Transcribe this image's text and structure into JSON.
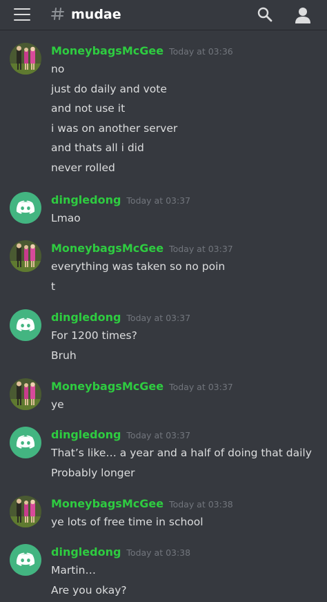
{
  "channel": {
    "name": "mudae"
  },
  "icons": {
    "menu": "hamburger-menu-icon",
    "channel": "text-channel-hash-icon",
    "search": "search-icon",
    "members": "members-icon"
  },
  "colors": {
    "background": "#36393f",
    "username": "#2ecc40",
    "timestamp": "#72767d",
    "text": "#dcddde",
    "discord_avatar": "#43b581"
  },
  "messages": [
    {
      "author": "MoneybagsMcGee",
      "avatar": "photo",
      "timestamp": "Today at 03:36",
      "lines": [
        "no",
        "just do daily and vote",
        "and not use it",
        "i was on another server",
        "and thats all i did",
        "never rolled"
      ]
    },
    {
      "author": "dingledong",
      "avatar": "discord",
      "timestamp": "Today at 03:37",
      "lines": [
        "Lmao"
      ]
    },
    {
      "author": "MoneybagsMcGee",
      "avatar": "photo",
      "timestamp": "Today at 03:37",
      "lines": [
        "everything was taken so no poin",
        "t"
      ]
    },
    {
      "author": "dingledong",
      "avatar": "discord",
      "timestamp": "Today at 03:37",
      "lines": [
        "For 1200 times?",
        "Bruh"
      ]
    },
    {
      "author": "MoneybagsMcGee",
      "avatar": "photo",
      "timestamp": "Today at 03:37",
      "lines": [
        "ye"
      ]
    },
    {
      "author": "dingledong",
      "avatar": "discord",
      "timestamp": "Today at 03:37",
      "lines": [
        "That’s like… a year and a half of doing that daily",
        "Probably longer"
      ]
    },
    {
      "author": "MoneybagsMcGee",
      "avatar": "photo",
      "timestamp": "Today at 03:38",
      "lines": [
        "ye lots of free time in school"
      ]
    },
    {
      "author": "dingledong",
      "avatar": "discord",
      "timestamp": "Today at 03:38",
      "lines": [
        "Martin…",
        "Are you okay?"
      ]
    }
  ]
}
